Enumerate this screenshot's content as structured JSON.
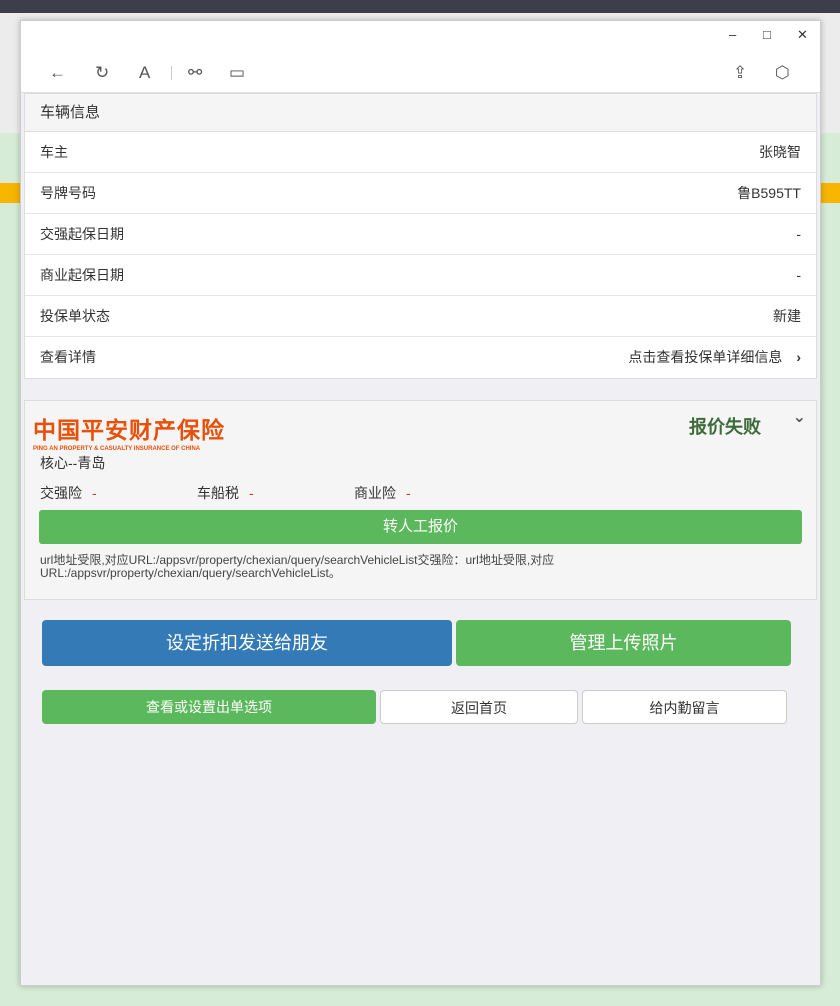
{
  "window": {
    "minimize": "–",
    "maximize": "□",
    "close": "✕"
  },
  "toolbar": {
    "back": "←",
    "refresh": "↻",
    "font": "A",
    "link": "⚯",
    "panel": "▭",
    "share": "⇪",
    "cube": "⬡"
  },
  "vehicle": {
    "title": "车辆信息",
    "rows": [
      {
        "label": "车主",
        "value": "张晓智"
      },
      {
        "label": "号牌号码",
        "value": "鲁B595TT"
      },
      {
        "label": "交强起保日期",
        "value": "-"
      },
      {
        "label": "商业起保日期",
        "value": "-"
      },
      {
        "label": "投保单状态",
        "value": "新建"
      },
      {
        "label": "查看详情",
        "value": "点击查看投保单详细信息"
      }
    ]
  },
  "insurer": {
    "logo_cn": "中国平安财产保险",
    "logo_en": "PING AN PROPERTY & CASUALTY INSURANCE OF CHINA",
    "status": "报价失败",
    "core": "核心--青岛",
    "premiums": [
      {
        "label": "交强险",
        "value": "-"
      },
      {
        "label": "车船税",
        "value": "-"
      },
      {
        "label": "商业险",
        "value": "-"
      }
    ],
    "manual_button": "转人工报价",
    "message": "url地址受限,对应URL:/appsvr/property/chexian/query/searchVehicleList交强险：url地址受限,对应URL:/appsvr/property/chexian/query/searchVehicleList。"
  },
  "actions": {
    "discount": "设定折扣发送给朋友",
    "photos": "管理上传照片",
    "options": "查看或设置出单选项",
    "home": "返回首页",
    "message": "给内勤留言"
  },
  "colors": {
    "blue": "#337ab7",
    "green": "#5cb85c",
    "logo": "#e8500a"
  }
}
